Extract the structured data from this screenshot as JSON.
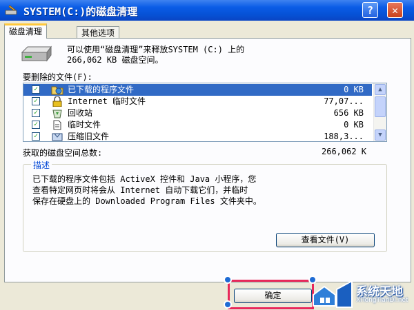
{
  "window": {
    "title": "SYSTEM(C:)的磁盘清理",
    "help_button": "?",
    "close_button": "✕"
  },
  "tabs": [
    {
      "label": "磁盘清理",
      "active": true
    },
    {
      "label": "其他选项",
      "active": false
    }
  ],
  "header": {
    "line1": "可以使用“磁盘清理”来释放SYSTEM (C:) 上的",
    "line2": "266,062 KB 磁盘空间。"
  },
  "files_label": "要删除的文件(F):",
  "files": [
    {
      "name": "已下载的程序文件",
      "size": "0 KB",
      "checked": true,
      "selected": true,
      "icon": "folder-globe-icon"
    },
    {
      "name": "Internet 临时文件",
      "size": "77,07...",
      "checked": true,
      "selected": false,
      "icon": "lock-icon"
    },
    {
      "name": "回收站",
      "size": "656 KB",
      "checked": true,
      "selected": false,
      "icon": "recycle-bin-icon"
    },
    {
      "name": "临时文件",
      "size": "0 KB",
      "checked": true,
      "selected": false,
      "icon": "document-icon"
    },
    {
      "name": "压缩旧文件",
      "size": "188,3...",
      "checked": true,
      "selected": false,
      "icon": "compress-icon"
    }
  ],
  "total": {
    "label": "获取的磁盘空间总数:",
    "value": "266,062 K"
  },
  "description": {
    "title": "描述",
    "lines": [
      "已下载的程序文件包括 ActiveX 控件和 Java 小程序，您",
      "查看特定网页时将会从 Internet 自动下载它们，并临时",
      "保存在硬盘上的 Downloaded Program Files 文件夹中。"
    ],
    "view_files_button": "查看文件(V)"
  },
  "ok_button": "确定",
  "watermark": {
    "title": "系统天地",
    "url": "XiTongTianDi.net"
  },
  "colors": {
    "titlebar": "#0a5ce6",
    "selection": "#316ac5",
    "highlight": "#e8285a",
    "group_title": "#0046d5"
  }
}
